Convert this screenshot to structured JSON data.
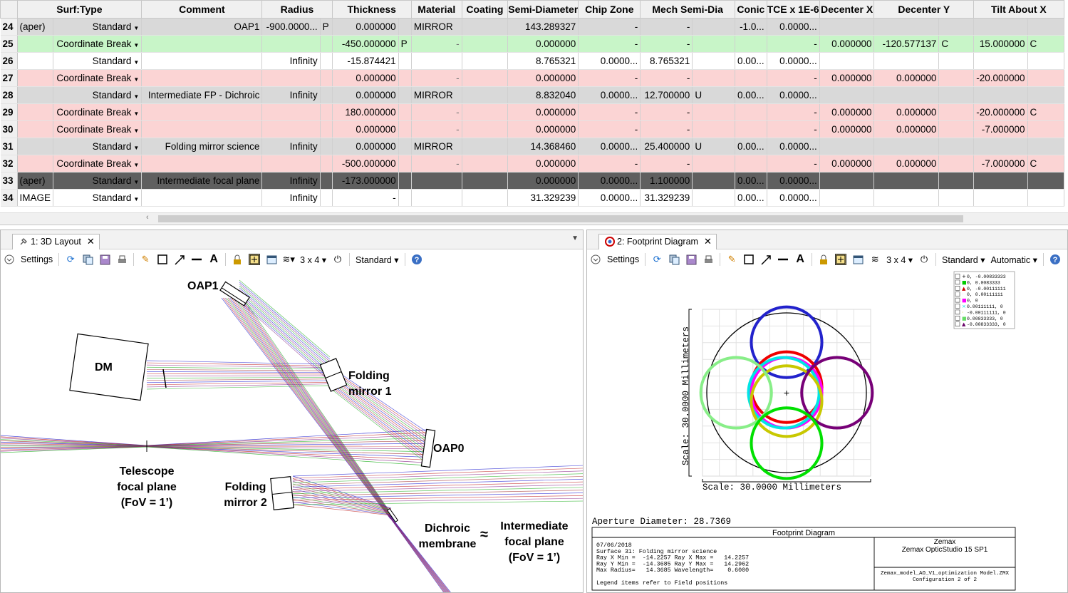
{
  "editor": {
    "columns": [
      "Surf:Type",
      "Comment",
      "Radius",
      "Thickness",
      "Material",
      "Coating",
      "Semi-Diameter",
      "Chip Zone",
      "Mech Semi-Dia",
      "Conic",
      "TCE x 1E-6",
      "Decenter X",
      "Decenter Y",
      "Tilt About X"
    ],
    "rows": [
      {
        "num": "24",
        "style": "gray",
        "pre": "(aper)",
        "type": "Standard",
        "comment": "OAP1",
        "radius": "-900.0000...",
        "rs": "P",
        "thickness": "0.000000",
        "ts": "",
        "material": "MIRROR",
        "semi": "143.289327",
        "chip": "-",
        "mech": "-",
        "ms": "",
        "conic": "-1.0...",
        "tce": "0.0000...",
        "dx": "",
        "dy": "",
        "dys": "",
        "tilt": "",
        "tls": ""
      },
      {
        "num": "25",
        "style": "green",
        "pre": "",
        "type": "Coordinate Break",
        "comment": "",
        "radius": "",
        "rs": "",
        "thickness": "-450.000000",
        "ts": "P",
        "material": "-",
        "semi": "0.000000",
        "chip": "-",
        "mech": "-",
        "ms": "",
        "conic": "",
        "tce": "-",
        "dx": "0.000000",
        "dy": "-120.577137",
        "dys": "C",
        "tilt": "15.000000",
        "tls": "C"
      },
      {
        "num": "26",
        "style": "white",
        "pre": "",
        "type": "Standard",
        "comment": "",
        "radius": "Infinity",
        "rs": "",
        "thickness": "-15.874421",
        "ts": "",
        "material": "",
        "semi": "8.765321",
        "chip": "0.0000...",
        "mech": "8.765321",
        "ms": "",
        "conic": "0.00...",
        "tce": "0.0000...",
        "dx": "",
        "dy": "",
        "dys": "",
        "tilt": "",
        "tls": ""
      },
      {
        "num": "27",
        "style": "pink",
        "pre": "",
        "type": "Coordinate Break",
        "comment": "",
        "radius": "",
        "rs": "",
        "thickness": "0.000000",
        "ts": "",
        "material": "-",
        "semi": "0.000000",
        "chip": "-",
        "mech": "-",
        "ms": "",
        "conic": "",
        "tce": "-",
        "dx": "0.000000",
        "dy": "0.000000",
        "dys": "",
        "tilt": "-20.000000",
        "tls": ""
      },
      {
        "num": "28",
        "style": "gray",
        "pre": "",
        "type": "Standard",
        "comment": "Intermediate FP - Dichroic",
        "radius": "Infinity",
        "rs": "",
        "thickness": "0.000000",
        "ts": "",
        "material": "MIRROR",
        "semi": "8.832040",
        "chip": "0.0000...",
        "mech": "12.700000",
        "ms": "U",
        "conic": "0.00...",
        "tce": "0.0000...",
        "dx": "",
        "dy": "",
        "dys": "",
        "tilt": "",
        "tls": ""
      },
      {
        "num": "29",
        "style": "pink",
        "pre": "",
        "type": "Coordinate Break",
        "comment": "",
        "radius": "",
        "rs": "",
        "thickness": "180.000000",
        "ts": "",
        "material": "-",
        "semi": "0.000000",
        "chip": "-",
        "mech": "-",
        "ms": "",
        "conic": "",
        "tce": "-",
        "dx": "0.000000",
        "dy": "0.000000",
        "dys": "",
        "tilt": "-20.000000",
        "tls": "C"
      },
      {
        "num": "30",
        "style": "pink",
        "pre": "",
        "type": "Coordinate Break",
        "comment": "",
        "radius": "",
        "rs": "",
        "thickness": "0.000000",
        "ts": "",
        "material": "-",
        "semi": "0.000000",
        "chip": "-",
        "mech": "-",
        "ms": "",
        "conic": "",
        "tce": "-",
        "dx": "0.000000",
        "dy": "0.000000",
        "dys": "",
        "tilt": "-7.000000",
        "tls": ""
      },
      {
        "num": "31",
        "style": "gray",
        "pre": "",
        "type": "Standard",
        "comment": "Folding mirror science",
        "radius": "Infinity",
        "rs": "",
        "thickness": "0.000000",
        "ts": "",
        "material": "MIRROR",
        "semi": "14.368460",
        "chip": "0.0000...",
        "mech": "25.400000",
        "ms": "U",
        "conic": "0.00...",
        "tce": "0.0000...",
        "dx": "",
        "dy": "",
        "dys": "",
        "tilt": "",
        "tls": ""
      },
      {
        "num": "32",
        "style": "pink",
        "pre": "",
        "type": "Coordinate Break",
        "comment": "",
        "radius": "",
        "rs": "",
        "thickness": "-500.000000",
        "ts": "",
        "material": "-",
        "semi": "0.000000",
        "chip": "-",
        "mech": "-",
        "ms": "",
        "conic": "",
        "tce": "-",
        "dx": "0.000000",
        "dy": "0.000000",
        "dys": "",
        "tilt": "-7.000000",
        "tls": "C"
      },
      {
        "num": "33",
        "style": "dark",
        "pre": "(aper)",
        "type": "Standard",
        "comment": "Intermediate focal plane",
        "radius": "Infinity",
        "rs": "",
        "thickness": "-173.000000",
        "ts": "",
        "material": "",
        "semi": "0.000000",
        "chip": "0.0000...",
        "mech": "1.100000",
        "ms": "",
        "conic": "0.00...",
        "tce": "0.0000...",
        "dx": "",
        "dy": "",
        "dys": "",
        "tilt": "",
        "tls": ""
      },
      {
        "num": "34",
        "style": "white",
        "pre": "IMAGE",
        "type": "Standard",
        "comment": "",
        "radius": "Infinity",
        "rs": "",
        "thickness": "-",
        "ts": "",
        "material": "",
        "semi": "31.329239",
        "chip": "0.0000...",
        "mech": "31.329239",
        "ms": "",
        "conic": "0.00...",
        "tce": "0.0000...",
        "dx": "",
        "dy": "",
        "dys": "",
        "tilt": "",
        "tls": ""
      }
    ]
  },
  "layout_panel": {
    "tab_label": "1: 3D Layout",
    "settings_label": "Settings",
    "grid_label": "3 x 4",
    "mode_label": "Standard",
    "labels": {
      "oap1": "OAP1",
      "dm": "DM",
      "folding1": [
        "Folding",
        "mirror 1"
      ],
      "oap0": "OAP0",
      "telescope": [
        "Telescope",
        "focal plane",
        "(FoV = 1’)"
      ],
      "folding2": [
        "Folding",
        "mirror 2"
      ],
      "dichroic": [
        "Dichroic",
        "membrane"
      ],
      "approx": "≈",
      "intermediate": [
        "Intermediate",
        "focal plane",
        "(FoV = 1’)"
      ]
    }
  },
  "footprint_panel": {
    "tab_label": "2: Footprint Diagram",
    "settings_label": "Settings",
    "grid_label": "3 x 4",
    "mode_label": "Standard",
    "auto_label": "Automatic",
    "legend": [
      {
        "sym": "+",
        "text": "0, -0.00833333",
        "color": "#000000"
      },
      {
        "sym": "■",
        "text": "0, 0.0083333",
        "color": "#00cc00"
      },
      {
        "sym": "▲",
        "text": "0, -0.00111111",
        "color": "#cc0000"
      },
      {
        "sym": "·",
        "text": "0, 0.00111111",
        "color": "#ff99ff"
      },
      {
        "sym": "■",
        "text": "0, 0",
        "color": "#ff00ff"
      },
      {
        "sym": "×",
        "text": "0.00111111, 0",
        "color": "#00dddd"
      },
      {
        "sym": "·",
        "text": "-0.00111111, 0",
        "color": "#cccc00"
      },
      {
        "sym": "■",
        "text": "0.00833333, 0",
        "color": "#66dd66"
      },
      {
        "sym": "▲",
        "text": "-0.00833333, 0",
        "color": "#660066"
      }
    ],
    "scale_y": "Scale: 30.0000 Millimeters",
    "scale_x": "Scale: 30.0000 Millimeters",
    "aperture": "Aperture Diameter: 28.7369",
    "title": "Footprint Diagram",
    "company": "Zemax",
    "product": "Zemax OpticStudio 15 SP1",
    "info": [
      "07/06/2018",
      "Surface 31: Folding mirror science",
      "Ray X Min =  -14.2257 Ray X Max =   14.2257",
      "Ray Y Min =  -14.3685 Ray Y Max =   14.2962",
      "Max Radius=   14.3685 Wavelength=    0.6000",
      "",
      "Legend items refer to Field positions"
    ],
    "file": "Zemax_model_AO_V1_optimization Model.ZMX",
    "config": "Configuration 2 of 2",
    "circles": [
      {
        "name": "blue",
        "color": "#2222cc",
        "cx": 0,
        "cy": 9.0
      },
      {
        "name": "red",
        "color": "#ee0000",
        "cx": 0,
        "cy": 1.0
      },
      {
        "name": "magenta",
        "color": "#ff00ff",
        "cx": 0,
        "cy": 0
      },
      {
        "name": "cyan",
        "color": "#00e5e5",
        "cx": -0.5,
        "cy": 0
      },
      {
        "name": "olive",
        "color": "#c8c800",
        "cx": 0,
        "cy": -1.5
      },
      {
        "name": "lightgreen",
        "color": "#88ee88",
        "cx": -9.0,
        "cy": 0
      },
      {
        "name": "purple",
        "color": "#770077",
        "cx": 9.0,
        "cy": 0
      },
      {
        "name": "green",
        "color": "#00e000",
        "cx": 0,
        "cy": -9.0
      }
    ]
  }
}
